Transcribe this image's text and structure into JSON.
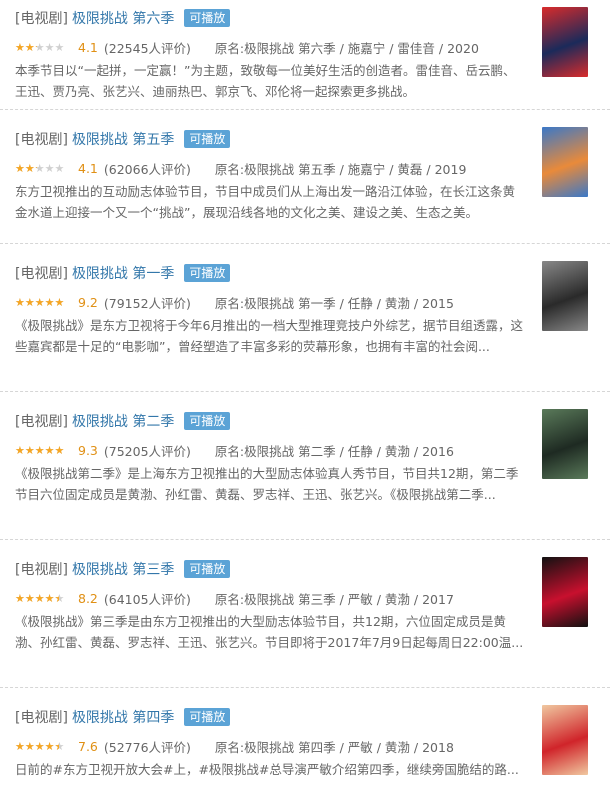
{
  "items": [
    {
      "category": "[电视剧]",
      "title": "极限挑战 第六季",
      "badge": "可播放",
      "rating_fraction": 0.4,
      "score": "4.1",
      "count": "(22545人评价)",
      "original": "原名:极限挑战 第六季 / 施嘉宁 / 雷佳音 / 2020",
      "description": "本季节目以“一起拼，一定赢！”为主题，致敬每一位美好生活的创造者。雷佳音、岳云鹏、王迅、贾乃亮、张艺兴、迪丽热巴、郭京飞、邓伦将一起探索更多挑战。",
      "poster_color": "#1b2a5a",
      "poster_accent": "#d92b2b"
    },
    {
      "category": "[电视剧]",
      "title": "极限挑战 第五季",
      "badge": "可播放",
      "rating_fraction": 0.4,
      "score": "4.1",
      "count": "(62066人评价)",
      "original": "原名:极限挑战 第五季 / 施嘉宁 / 黄磊 / 2019",
      "description": "东方卫视推出的互动励志体验节目，节目中成员们从上海出发一路沿江体验，在长江这条黄金水道上迎接一个又一个“挑战”，展现沿线各地的文化之美、建设之美、生态之美。",
      "poster_color": "#e98a3a",
      "poster_accent": "#3a78c8"
    },
    {
      "category": "[电视剧]",
      "title": "极限挑战 第一季",
      "badge": "可播放",
      "rating_fraction": 0.9,
      "score": "9.2",
      "count": "(79152人评价)",
      "original": "原名:极限挑战 第一季 / 任静 / 黄渤 / 2015",
      "description": "《极限挑战》是东方卫视将于今年6月推出的一档大型推理竞技户外综艺，据节目组透露，这些嘉宾都是十足的“电影咖”，曾经塑造了丰富多彩的荧幕形象，也拥有丰富的社会阅...",
      "poster_color": "#2a2a2a",
      "poster_accent": "#888888"
    },
    {
      "category": "[电视剧]",
      "title": "极限挑战 第二季",
      "badge": "可播放",
      "rating_fraction": 0.9,
      "score": "9.3",
      "count": "(75205人评价)",
      "original": "原名:极限挑战 第二季 / 任静 / 黄渤 / 2016",
      "description": "《极限挑战第二季》是上海东方卫视推出的大型励志体验真人秀节目，节目共12期，第二季节目六位固定成员是黄渤、孙红雷、黄磊、罗志祥、王迅、张艺兴。《极限挑战第二季...",
      "poster_color": "#1e2a22",
      "poster_accent": "#5a7a5a"
    },
    {
      "category": "[电视剧]",
      "title": "极限挑战 第三季",
      "badge": "可播放",
      "rating_fraction": 0.8,
      "score": "8.2",
      "count": "(64105人评价)",
      "original": "原名:极限挑战 第三季 / 严敏 / 黄渤 / 2017",
      "description": "《极限挑战》第三季是由东方卫视推出的大型励志体验节目，共12期，六位固定成员是黄渤、孙红雷、黄磊、罗志祥、王迅、张艺兴。节目即将于2017年7月9日起每周日22:00温...",
      "poster_color": "#c8102e",
      "poster_accent": "#111111"
    },
    {
      "category": "[电视剧]",
      "title": "极限挑战 第四季",
      "badge": "可播放",
      "rating_fraction": 0.8,
      "score": "7.6",
      "count": "(52776人评价)",
      "original": "原名:极限挑战 第四季 / 严敏 / 黄渤 / 2018",
      "description": "日前的#东方卫视开放大会#上，#极限挑战#总导演严敏介绍第四季，继续旁国脆结的路...",
      "poster_color": "#d0242a",
      "poster_accent": "#f0c8a0"
    }
  ]
}
